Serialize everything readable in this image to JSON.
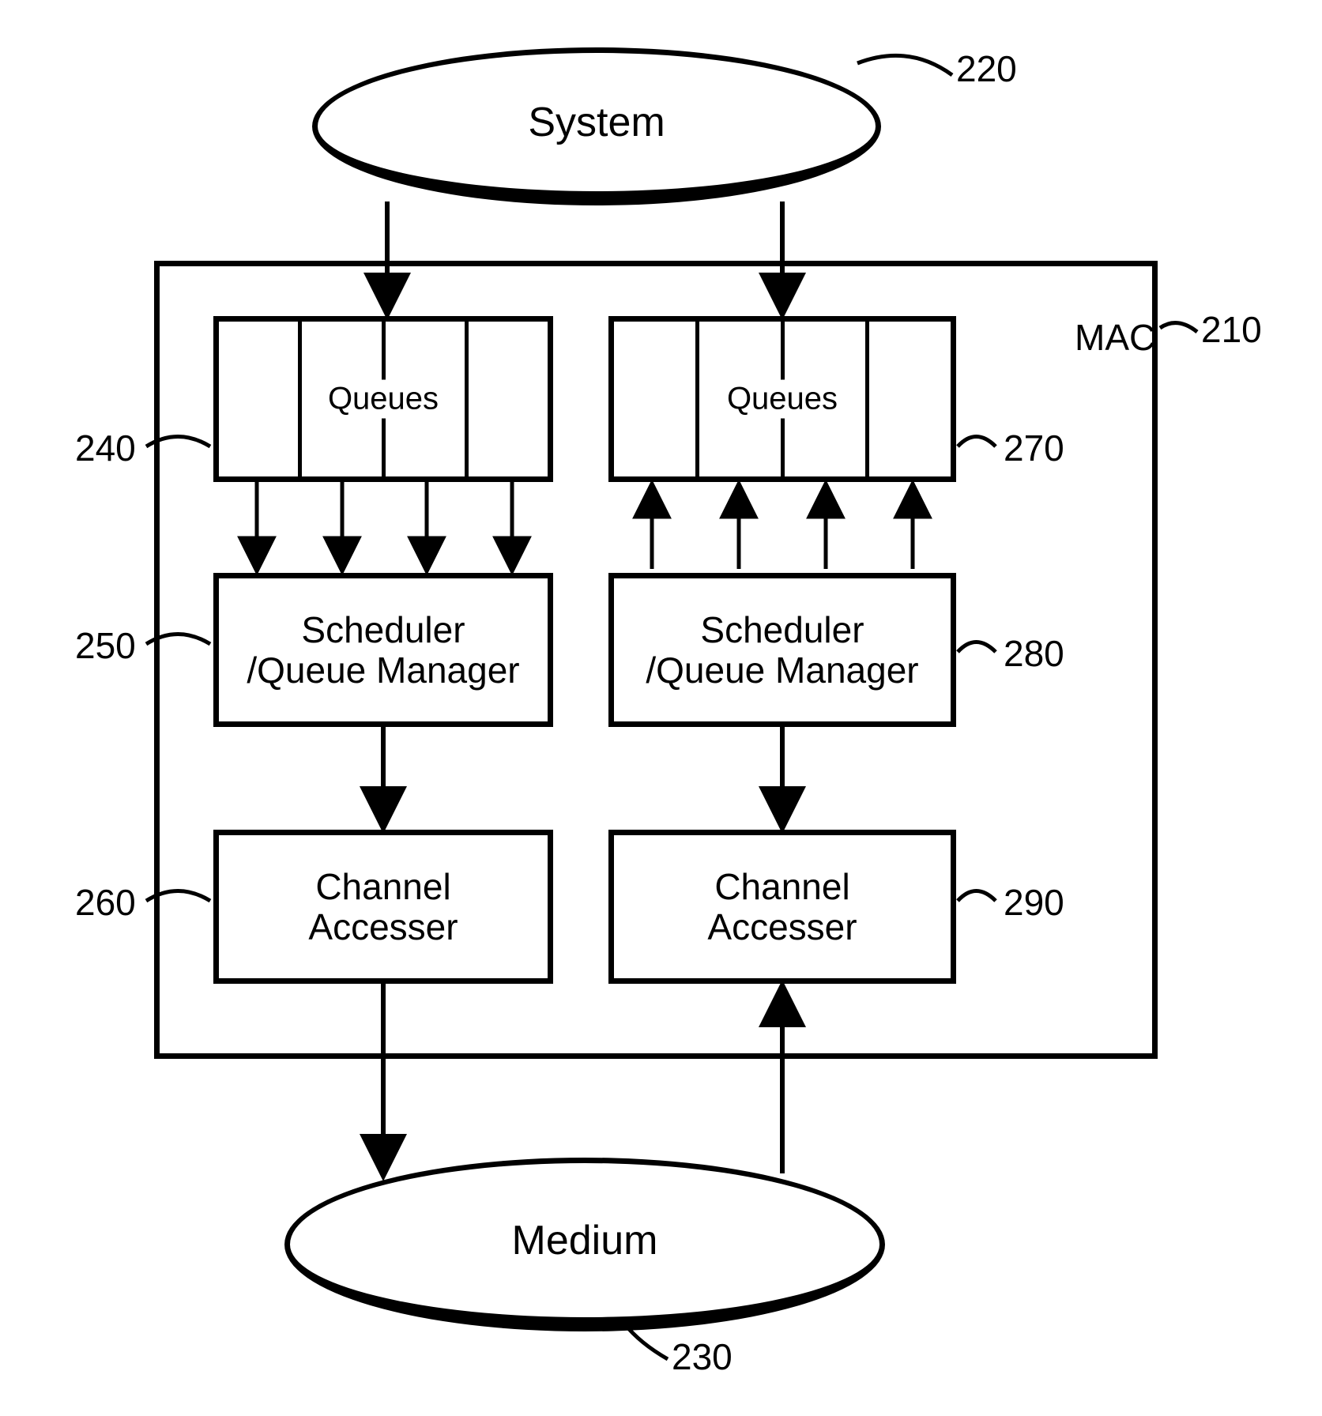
{
  "refs": {
    "r210": "210",
    "r220": "220",
    "r230": "230",
    "r240": "240",
    "r250": "250",
    "r260": "260",
    "r270": "270",
    "r280": "280",
    "r290": "290"
  },
  "nodes": {
    "system": "System",
    "mac": "MAC",
    "queues_left": "Queues",
    "queues_right": "Queues",
    "scheduler_left_line1": "Scheduler",
    "scheduler_left_line2": "/Queue Manager",
    "scheduler_right_line1": "Scheduler",
    "scheduler_right_line2": "/Queue Manager",
    "channel_left_line1": "Channel",
    "channel_left_line2": "Accesser",
    "channel_right_line1": "Channel",
    "channel_right_line2": "Accesser",
    "medium": "Medium"
  }
}
